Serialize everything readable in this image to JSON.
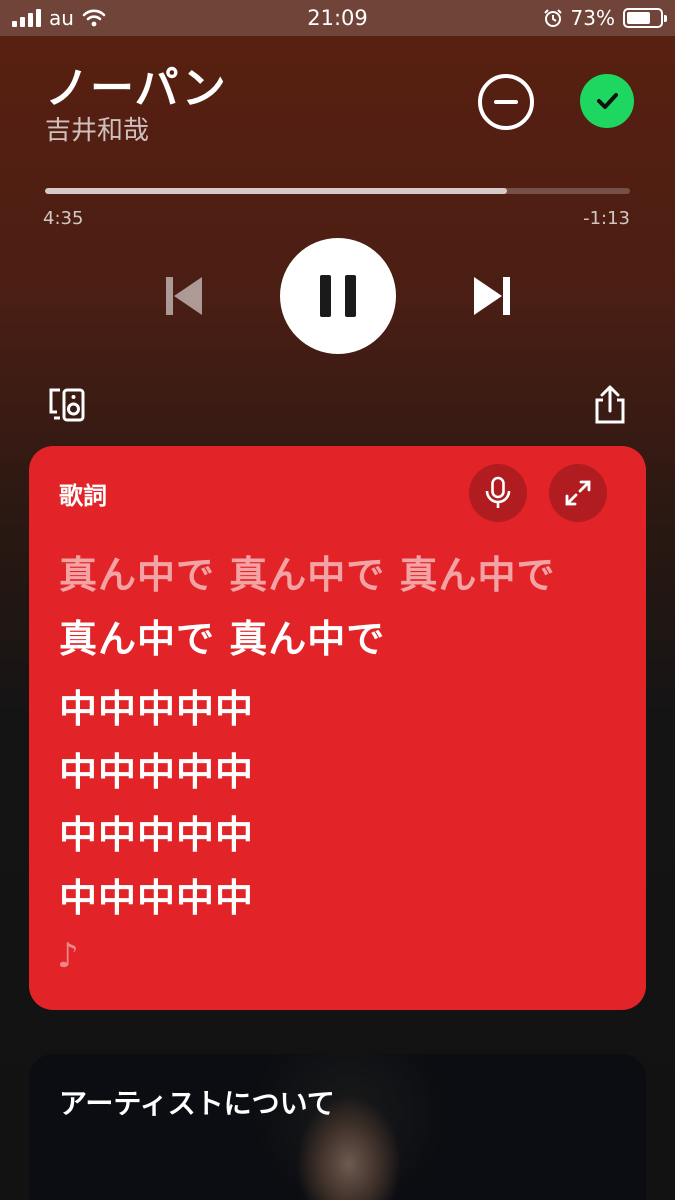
{
  "status_bar": {
    "carrier": "au",
    "time": "21:09",
    "battery_percent": "73%",
    "battery_level": 0.73
  },
  "track": {
    "title": "ノーパン",
    "artist": "吉井和哉"
  },
  "playback": {
    "elapsed": "4:35",
    "remaining": "-1:13",
    "progress": 0.79,
    "state": "playing"
  },
  "icons": {
    "remove": "minus-circle-icon",
    "saved": "check-circle-icon",
    "previous": "skip-previous-icon",
    "pause": "pause-icon",
    "next": "skip-next-icon",
    "devices": "connect-device-icon",
    "share": "share-icon",
    "mic": "microphone-icon",
    "expand": "expand-icon",
    "note": "music-note-icon"
  },
  "colors": {
    "accent_green": "#1ed760",
    "lyrics_card": "#e22428"
  },
  "lyrics": {
    "heading": "歌詞",
    "lines": [
      {
        "text": "真ん中で 真ん中で 真ん中で",
        "state": "past"
      },
      {
        "text": "真ん中で 真ん中で",
        "state": "current"
      },
      {
        "text": "中中中中中",
        "state": "upcoming"
      },
      {
        "text": "中中中中中",
        "state": "upcoming"
      },
      {
        "text": "中中中中中",
        "state": "upcoming"
      },
      {
        "text": "中中中中中",
        "state": "upcoming"
      }
    ],
    "note": "♪"
  },
  "artist_section": {
    "heading": "アーティストについて"
  }
}
